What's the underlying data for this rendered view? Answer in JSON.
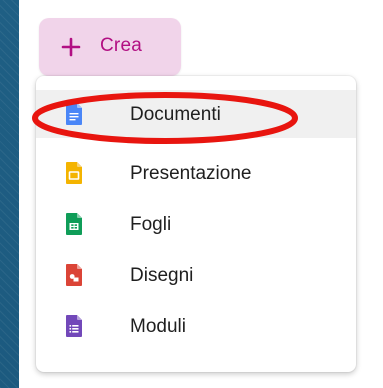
{
  "create_button": {
    "label": "Crea",
    "icon": "plus-icon",
    "color": "#b20f83",
    "background": "#f1d4ea"
  },
  "menu": {
    "items": [
      {
        "label": "Documenti",
        "icon": "google-docs-icon",
        "color": "#4a86f7",
        "highlighted": true
      },
      {
        "label": "Presentazione",
        "icon": "google-slides-icon",
        "color": "#f4b400",
        "highlighted": false
      },
      {
        "label": "Fogli",
        "icon": "google-sheets-icon",
        "color": "#0f9d58",
        "highlighted": false
      },
      {
        "label": "Disegni",
        "icon": "google-drawings-icon",
        "color": "#db4437",
        "highlighted": false
      },
      {
        "label": "Moduli",
        "icon": "google-forms-icon",
        "color": "#7248b9",
        "highlighted": false
      }
    ]
  },
  "annotation": {
    "shape": "ellipse",
    "color": "#e8150f",
    "target": "Documenti"
  }
}
